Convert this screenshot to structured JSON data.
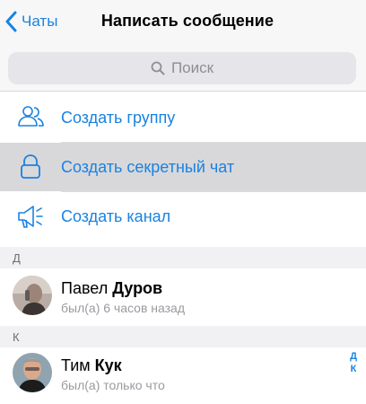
{
  "nav": {
    "back_label": "Чаты",
    "title": "Написать сообщение"
  },
  "search": {
    "placeholder": "Поиск"
  },
  "actions": [
    {
      "label": "Создать группу",
      "icon": "group-icon"
    },
    {
      "label": "Создать секретный чат",
      "icon": "lock-icon"
    },
    {
      "label": "Создать канал",
      "icon": "megaphone-icon"
    }
  ],
  "sections": [
    {
      "letter": "Д",
      "contacts": [
        {
          "first": "Павел",
          "last": "Дуров",
          "status": "был(а) 6 часов назад"
        }
      ]
    },
    {
      "letter": "К",
      "contacts": [
        {
          "first": "Тим",
          "last": "Кук",
          "status": "был(а) только что"
        }
      ]
    }
  ],
  "index": [
    "Д",
    "К"
  ],
  "colors": {
    "accent": "#1a82e2",
    "highlight": "#d8d8da",
    "secondary_text": "#9a9aa0"
  }
}
